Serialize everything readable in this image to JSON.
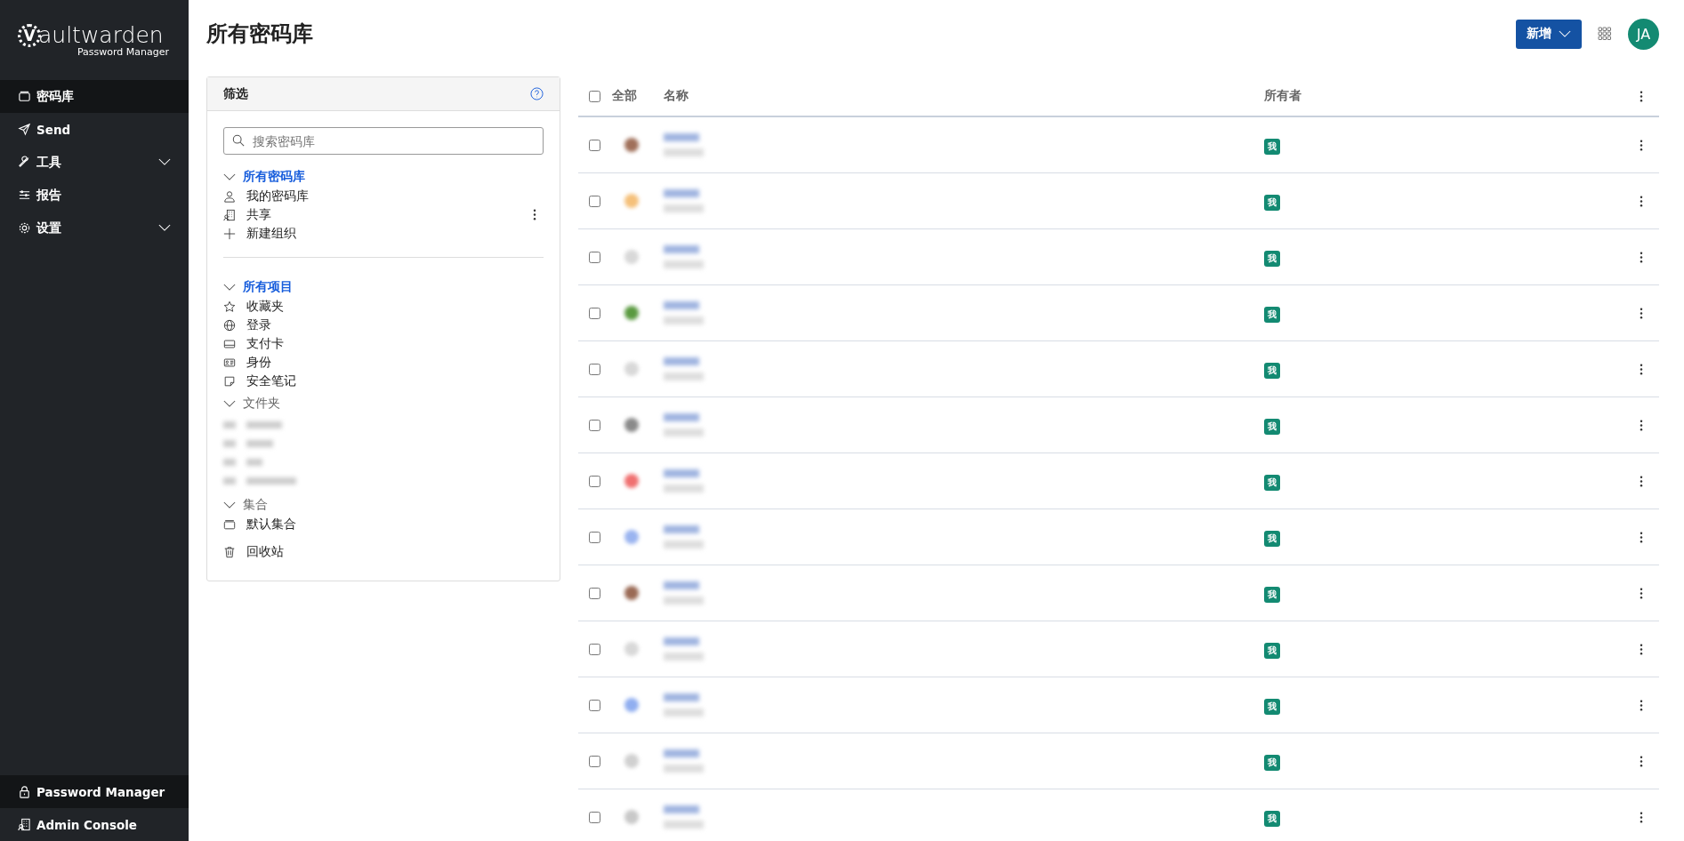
{
  "logo": {
    "name": "Vaultwarden",
    "subtitle": "Password Manager"
  },
  "nav": [
    {
      "label": "密码库",
      "selected": true,
      "has_submenu": false
    },
    {
      "label": "Send",
      "selected": false,
      "has_submenu": false
    },
    {
      "label": "工具",
      "selected": false,
      "has_submenu": true
    },
    {
      "label": "报告",
      "selected": false,
      "has_submenu": false
    },
    {
      "label": "设置",
      "selected": false,
      "has_submenu": true
    }
  ],
  "switcher": [
    {
      "label": "Password Manager",
      "selected": true
    },
    {
      "label": "Admin Console",
      "selected": false
    }
  ],
  "page_title": "所有密码库",
  "new_button": "新增",
  "avatar": "JA",
  "filter": {
    "title": "筛选",
    "search": {
      "placeholder": "搜索密码库"
    },
    "vaults": {
      "label": "所有密码库",
      "selected": true,
      "expanded": true,
      "items": [
        {
          "label": "我的密码库",
          "has_menu": false
        },
        {
          "label": "共享",
          "has_menu": true
        },
        {
          "label": "新建组织",
          "has_menu": false
        }
      ]
    },
    "types": {
      "label": "所有项目",
      "selected": true,
      "expanded": true,
      "items": [
        {
          "label": "收藏夹"
        },
        {
          "label": "登录"
        },
        {
          "label": "支付卡"
        },
        {
          "label": "身份"
        },
        {
          "label": "安全笔记"
        }
      ]
    },
    "folders": {
      "label": "文件夹",
      "selected": false,
      "expanded": true
    },
    "collections": {
      "label": "集合",
      "selected": false,
      "expanded": true,
      "items": [
        {
          "label": "默认集合"
        }
      ]
    },
    "trash": "回收站"
  },
  "table": {
    "select_all": {
      "label": "全部",
      "checked": false
    },
    "columns": [
      "名称",
      "所有者"
    ],
    "rows": [
      {
        "checked": false,
        "color": "#a0705a",
        "owner": "我"
      },
      {
        "checked": false,
        "color": "#f5c07a",
        "owner": "我"
      },
      {
        "checked": false,
        "color": "#d8d8d8",
        "owner": "我"
      },
      {
        "checked": false,
        "color": "#5a9a40",
        "owner": "我"
      },
      {
        "checked": false,
        "color": "#d8d8d8",
        "owner": "我"
      },
      {
        "checked": false,
        "color": "#8a8a8a",
        "owner": "我"
      },
      {
        "checked": false,
        "color": "#f07070",
        "owner": "我"
      },
      {
        "checked": false,
        "color": "#9ab4f0",
        "owner": "我"
      },
      {
        "checked": false,
        "color": "#9a6a55",
        "owner": "我"
      },
      {
        "checked": false,
        "color": "#d8d8d8",
        "owner": "我"
      },
      {
        "checked": false,
        "color": "#90aef0",
        "owner": "我"
      },
      {
        "checked": false,
        "color": "#d0d0d0",
        "owner": "我"
      },
      {
        "checked": false,
        "color": "#c8c8c8",
        "owner": "我"
      }
    ]
  }
}
